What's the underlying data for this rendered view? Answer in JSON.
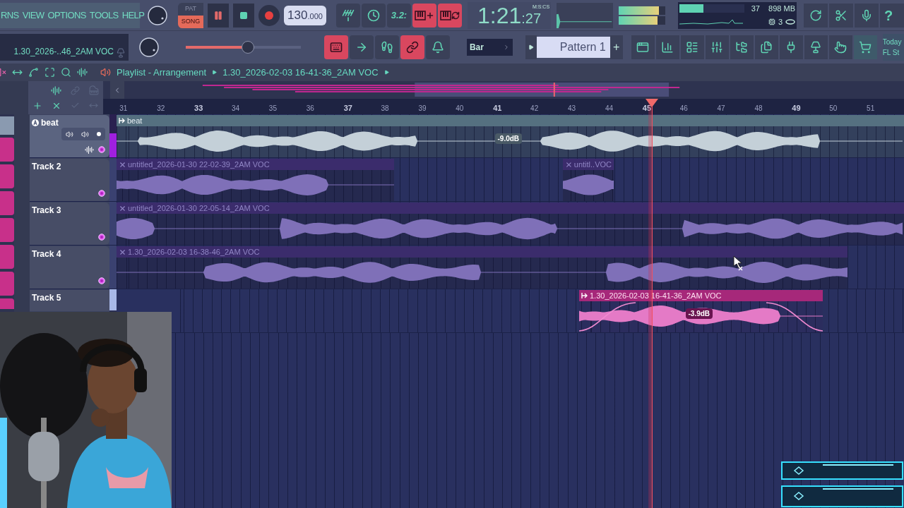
{
  "menu": [
    {
      "label": "RNS"
    },
    {
      "label": "VIEW"
    },
    {
      "label": "OPTIONS"
    },
    {
      "label": "TOOLS"
    },
    {
      "label": "HELP"
    }
  ],
  "hint": "1.30_2026-..46_2AM VOC",
  "modes": [
    {
      "label": "PAT",
      "selected": false
    },
    {
      "label": "SONG",
      "selected": true
    }
  ],
  "playing": true,
  "tempo": "130",
  "tempo_decimals": ".000",
  "master_volume": {
    "level": 0.54
  },
  "tools_top": [
    {
      "kind": "antenna",
      "on": false
    },
    {
      "kind": "clock",
      "on": false
    },
    {
      "kind": "label",
      "label": "3.2:",
      "on": false
    },
    {
      "kind": "keys-plus",
      "on": true
    },
    {
      "kind": "keys-loop",
      "on": true
    }
  ],
  "tools_bottom": [
    {
      "kind": "keyboard",
      "on": true
    },
    {
      "kind": "arrow",
      "on": false
    },
    {
      "kind": "footprints",
      "on": false
    },
    {
      "kind": "link",
      "on": true
    },
    {
      "kind": "bell",
      "on": false
    }
  ],
  "time": {
    "main": "1:21",
    "centiseconds": ":27",
    "unit": "M:S:CS"
  },
  "peak_meters": [
    {
      "level": 0.87
    },
    {
      "level": 0.84
    }
  ],
  "cpu": {
    "level": 0.37,
    "reading": "37"
  },
  "memory": "898 MB",
  "polyphony": "3",
  "help": "?",
  "snap": "Bar",
  "pattern": "Pattern 1",
  "add": "+",
  "hint_panel": {
    "line_1": "Today",
    "line_2": "FL St"
  },
  "playlist": {
    "title": "Playlist - Arrangement",
    "clip": "1.30_2026-02-03 16-41-36_2AM VOC"
  },
  "ruler": [
    {
      "label": "31",
      "major": false
    },
    {
      "label": "32",
      "major": false
    },
    {
      "label": "33",
      "major": true
    },
    {
      "label": "34",
      "major": false
    },
    {
      "label": "35",
      "major": false
    },
    {
      "label": "36",
      "major": false
    },
    {
      "label": "37",
      "major": true
    },
    {
      "label": "38",
      "major": false
    },
    {
      "label": "39",
      "major": false
    },
    {
      "label": "40",
      "major": false
    },
    {
      "label": "41",
      "major": true
    },
    {
      "label": "42",
      "major": false
    },
    {
      "label": "43",
      "major": false
    },
    {
      "label": "44",
      "major": false
    },
    {
      "label": "45",
      "major": true
    },
    {
      "label": "46",
      "major": false
    },
    {
      "label": "47",
      "major": false
    },
    {
      "label": "48",
      "major": false
    },
    {
      "label": "49",
      "major": true
    },
    {
      "label": "50",
      "major": false
    },
    {
      "label": "51",
      "major": false
    }
  ],
  "tracks": [
    {
      "name": "beat",
      "kind": "beat",
      "selected": false,
      "clips": [
        {
          "label": "beat",
          "selected": false,
          "volume": "-9.0dB"
        }
      ]
    },
    {
      "name": "Track 2",
      "kind": "audio",
      "selected": false,
      "clips": [
        {
          "label": "untitled_2026-01-30 22-02-39_2AM VOC",
          "selected": false
        },
        {
          "label": "untitl..VOC",
          "selected": false
        }
      ]
    },
    {
      "name": "Track 3",
      "kind": "audio",
      "selected": false,
      "clips": [
        {
          "label": "untitled_2026-01-30 22-05-14_2AM VOC",
          "selected": false
        }
      ]
    },
    {
      "name": "Track 4",
      "kind": "audio",
      "selected": false,
      "clips": [
        {
          "label": "1.30_2026-02-03 16-38-46_2AM VOC",
          "selected": false
        }
      ]
    },
    {
      "name": "Track 5",
      "kind": "audio",
      "selected": true,
      "clips": [
        {
          "label": "1.30_2026-02-03 16-41-36_2AM VOC",
          "selected": true,
          "volume": "-3.9dB"
        }
      ]
    }
  ]
}
